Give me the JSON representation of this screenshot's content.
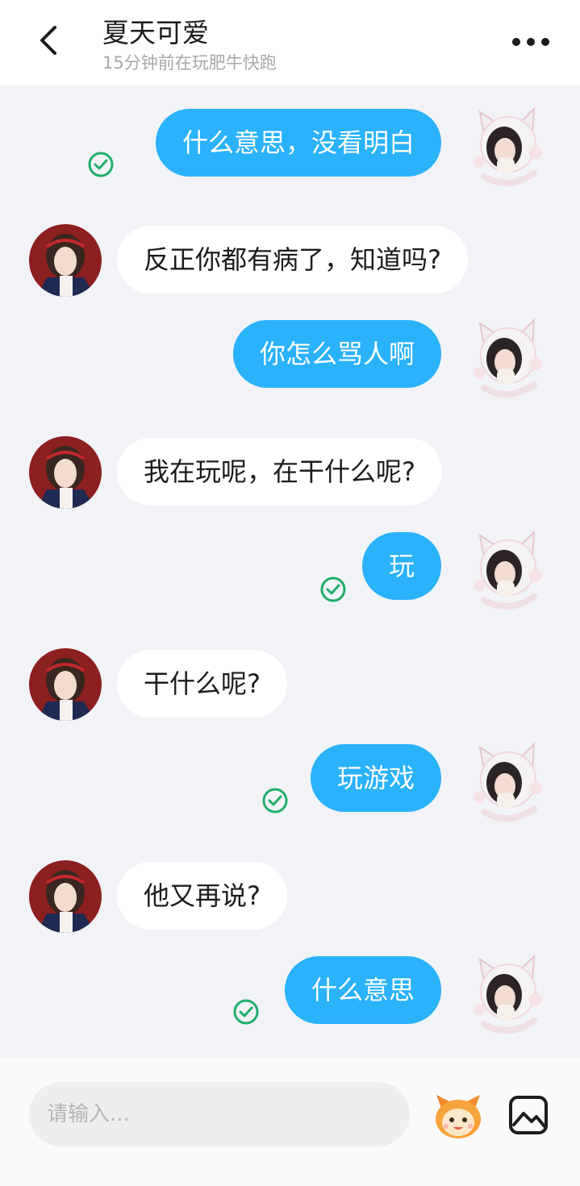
{
  "header": {
    "title": "夏天可爱",
    "subtitle": "15分钟前在玩肥牛快跑"
  },
  "messages": [
    {
      "side": "out",
      "text": "什么意思，没看明白",
      "read": true
    },
    {
      "side": "in",
      "text": "反正你都有病了，知道吗?"
    },
    {
      "side": "out",
      "text": "你怎么骂人啊",
      "read": false
    },
    {
      "side": "in",
      "text": "我在玩呢，在干什么呢?"
    },
    {
      "side": "out",
      "text": "玩",
      "read": true
    },
    {
      "side": "in",
      "text": "干什么呢?"
    },
    {
      "side": "out",
      "text": "玩游戏",
      "read": true
    },
    {
      "side": "in",
      "text": "他又再说?"
    },
    {
      "side": "out",
      "text": "什么意思",
      "read": true
    }
  ],
  "composer": {
    "placeholder": "请输入..."
  },
  "icons": {
    "back": "chevron-left-icon",
    "more": "more-dots-icon",
    "read": "check-circle-icon",
    "emoji": "sticker-face-icon",
    "image": "image-icon"
  },
  "colors": {
    "outgoing_bubble": "#2ab2fb",
    "incoming_bubble": "#ffffff",
    "read_check": "#1fae6b",
    "background": "#f1f3f7"
  }
}
